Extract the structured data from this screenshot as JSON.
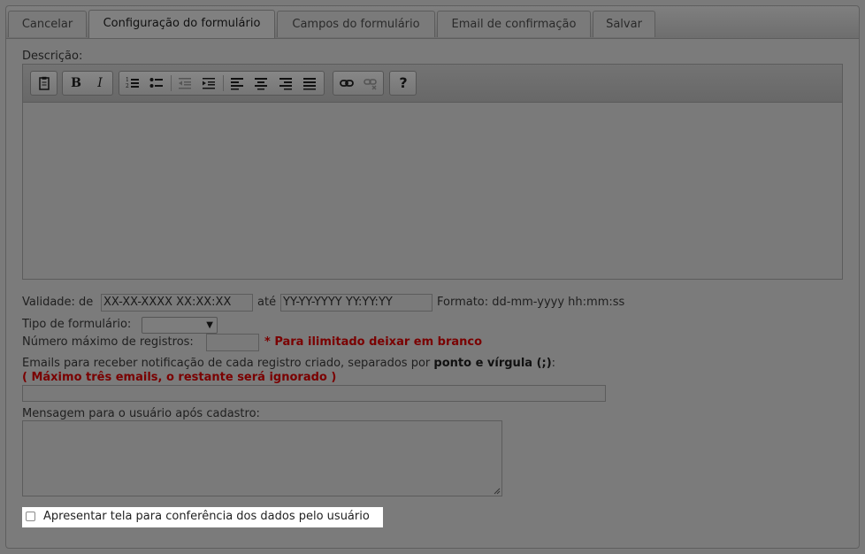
{
  "tabs": [
    {
      "label": "Cancelar",
      "active": false
    },
    {
      "label": "Configuração do formulário",
      "active": true
    },
    {
      "label": "Campos do formulário",
      "active": false
    },
    {
      "label": "Email de confirmação",
      "active": false
    },
    {
      "label": "Salvar",
      "active": false
    }
  ],
  "description": {
    "label": "Descrição:",
    "toolbar": {
      "bold": "B",
      "italic": "I",
      "help": "?",
      "icons": [
        "paste-icon",
        "bold-icon",
        "italic-icon",
        "ordered-list-icon",
        "unordered-list-icon",
        "outdent-icon",
        "indent-icon",
        "align-left-icon",
        "align-center-icon",
        "align-right-icon",
        "align-justify-icon",
        "link-icon",
        "unlink-icon",
        "help-icon"
      ]
    },
    "content": ""
  },
  "validity": {
    "label": "Validade: de",
    "from_value": "XX-XX-XXXX XX:XX:XX",
    "to_label": "até",
    "to_value": "YY-YY-YYYY YY:YY:YY",
    "format_label": "Formato: dd-mm-yyyy hh:mm:ss"
  },
  "form_type": {
    "label": "Tipo de formulário:",
    "selected": ""
  },
  "max_records": {
    "label": "Número máximo de registros:",
    "value": "",
    "hint": "* Para ilimitado deixar em branco"
  },
  "notification_emails": {
    "label": "Emails para receber notificação de cada registro criado, separados por",
    "label_bold": "ponto e vírgula (;)",
    "label_end": ":",
    "warning": "( Máximo três emails, o restante será ignorado )",
    "value": ""
  },
  "user_message": {
    "label": "Mensagem para o usuário após cadastro:",
    "value": ""
  },
  "confirmation_screen": {
    "label": "Apresentar tela para conferência dos dados pelo usuário",
    "checked": false
  },
  "colors": {
    "background": "#7a7a7a",
    "warning_red": "#7a0000",
    "highlight": "#ffffff"
  }
}
